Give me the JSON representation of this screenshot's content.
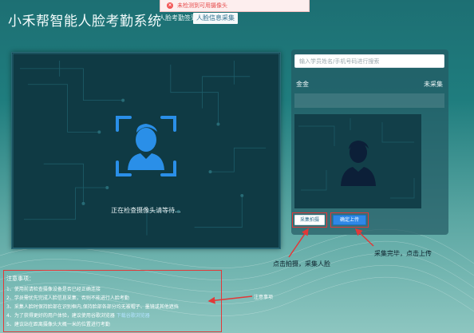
{
  "header": {
    "app_title": "小禾帮智能人脸考勤系统",
    "tabs": [
      {
        "label": "人脸考勤签到",
        "active": false
      },
      {
        "label": "人脸信息采集",
        "active": true
      }
    ]
  },
  "toast": {
    "icon": "error-icon",
    "message": "未检测到可用摄像头",
    "color": "#e64b4b"
  },
  "camera": {
    "status": "正在检查摄像头请等待..."
  },
  "side": {
    "search_placeholder": "输入学员姓名/手机号码进行搜索",
    "person": {
      "name": "金金",
      "status": "未采集"
    },
    "buttons": {
      "capture": "采集拍摄",
      "upload": "确定上传"
    }
  },
  "annotations": {
    "capture": "点击拍摄，采集人脸",
    "upload": "采集完毕，点击上传",
    "notes": "注意事项"
  },
  "notes": {
    "title": "注意事项：",
    "items": [
      "1、使用前请检查摄像设备是否已经正确连接",
      "2、学员需优先完成人脸信息采集，否则不能进行人脸考勤",
      "3、采集人脸时保持脸部在识别框内,保持脸部各部分均无被帽子、墨镜或其他遮挡",
      "4、为了获得更好的用户体验，建议使用谷歌浏览器",
      "5、建议站在距离摄像头大概一米的位置进行考勤"
    ],
    "download_link": "下载谷歌浏览器"
  },
  "colors": {
    "accent_blue": "#2f88e6",
    "annotation_red": "#e23838",
    "panel_dark": "#0f3a44"
  }
}
